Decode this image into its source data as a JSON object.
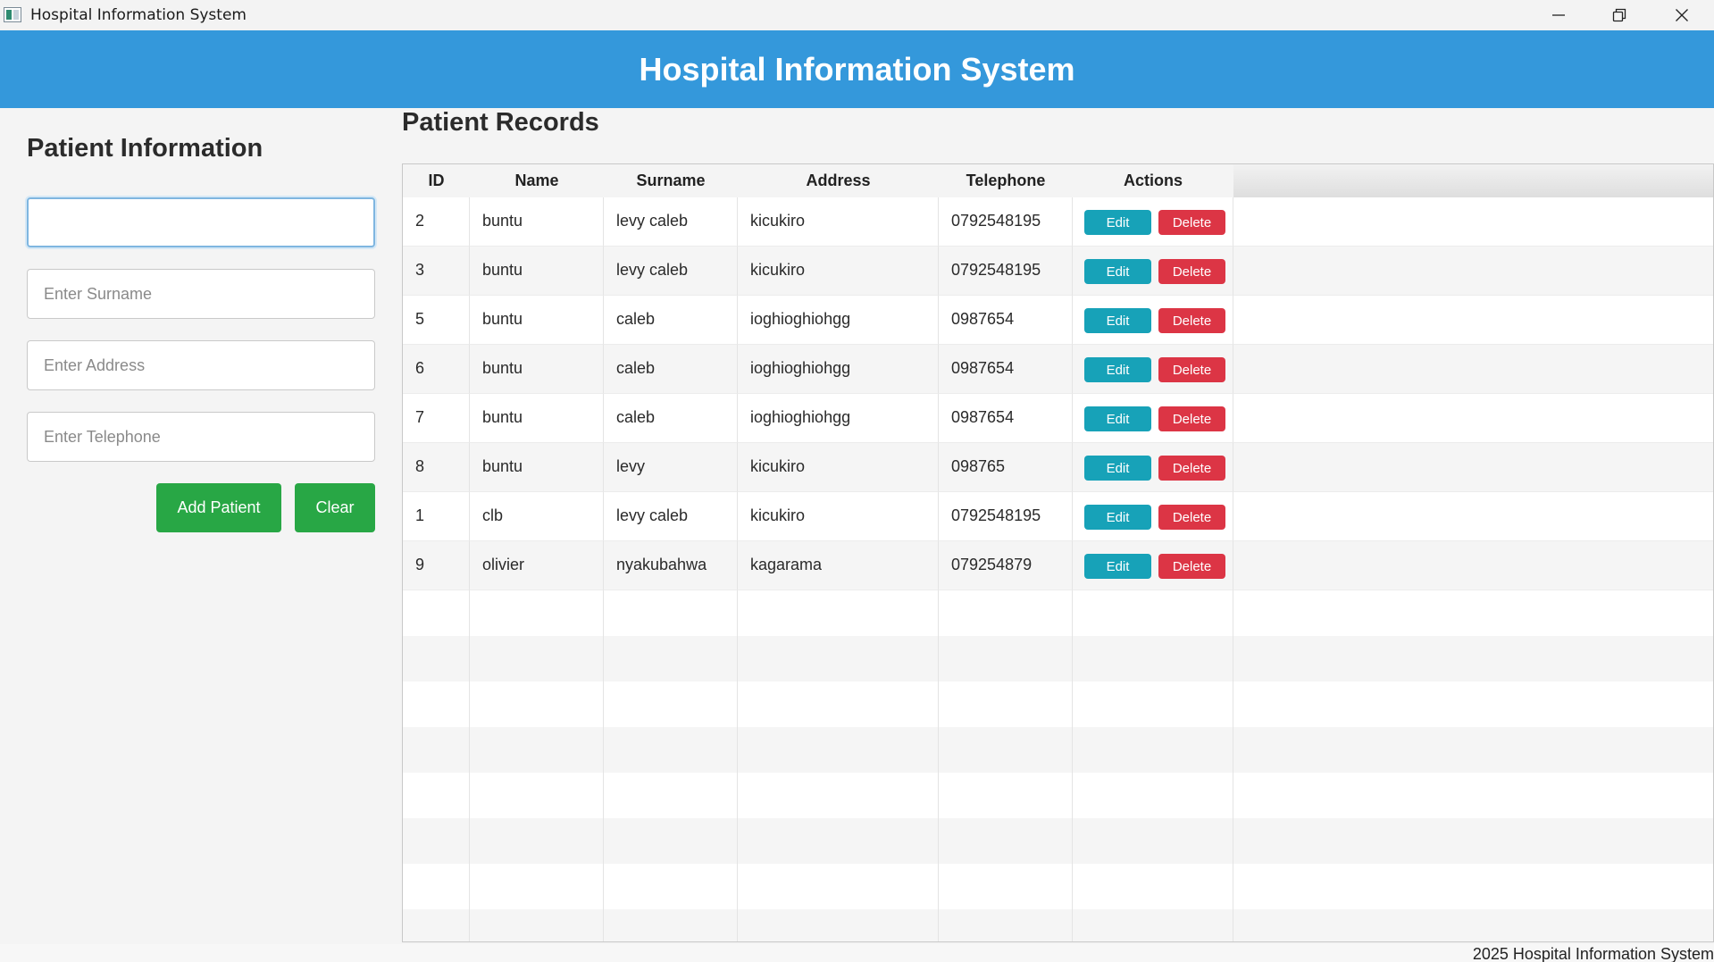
{
  "window": {
    "title": "Hospital Information System"
  },
  "header": {
    "title": "Hospital Information System"
  },
  "form": {
    "title": "Patient Information",
    "name_value": "",
    "surname_placeholder": "Enter Surname",
    "address_placeholder": "Enter Address",
    "telephone_placeholder": "Enter Telephone",
    "add_label": "Add Patient",
    "clear_label": "Clear"
  },
  "records": {
    "title": "Patient Records",
    "columns": [
      "ID",
      "Name",
      "Surname",
      "Address",
      "Telephone",
      "Actions"
    ],
    "edit_label": "Edit",
    "delete_label": "Delete",
    "rows": [
      {
        "id": "2",
        "name": "buntu",
        "surname": "levy caleb",
        "address": "kicukiro",
        "telephone": "0792548195"
      },
      {
        "id": "3",
        "name": "buntu",
        "surname": "levy caleb",
        "address": "kicukiro",
        "telephone": "0792548195"
      },
      {
        "id": "5",
        "name": "buntu",
        "surname": "caleb",
        "address": "ioghioghiohgg",
        "telephone": "0987654"
      },
      {
        "id": "6",
        "name": "buntu",
        "surname": "caleb",
        "address": "ioghioghiohgg",
        "telephone": "0987654"
      },
      {
        "id": "7",
        "name": "buntu",
        "surname": "caleb",
        "address": "ioghioghiohgg",
        "telephone": "0987654"
      },
      {
        "id": "8",
        "name": "buntu",
        "surname": "levy",
        "address": "kicukiro",
        "telephone": "098765"
      },
      {
        "id": "1",
        "name": "clb",
        "surname": "levy caleb",
        "address": "kicukiro",
        "telephone": "0792548195"
      },
      {
        "id": "9",
        "name": "olivier",
        "surname": "nyakubahwa",
        "address": "kagarama",
        "telephone": "079254879"
      }
    ]
  },
  "footer": {
    "text": "2025 Hospital Information System"
  },
  "colors": {
    "header": "#3498db",
    "primary_button": "#28a745",
    "edit_button": "#17a2b8",
    "delete_button": "#dc3545"
  },
  "icons": {
    "minimize": "minimize-icon",
    "restore": "restore-icon",
    "close": "close-icon"
  }
}
